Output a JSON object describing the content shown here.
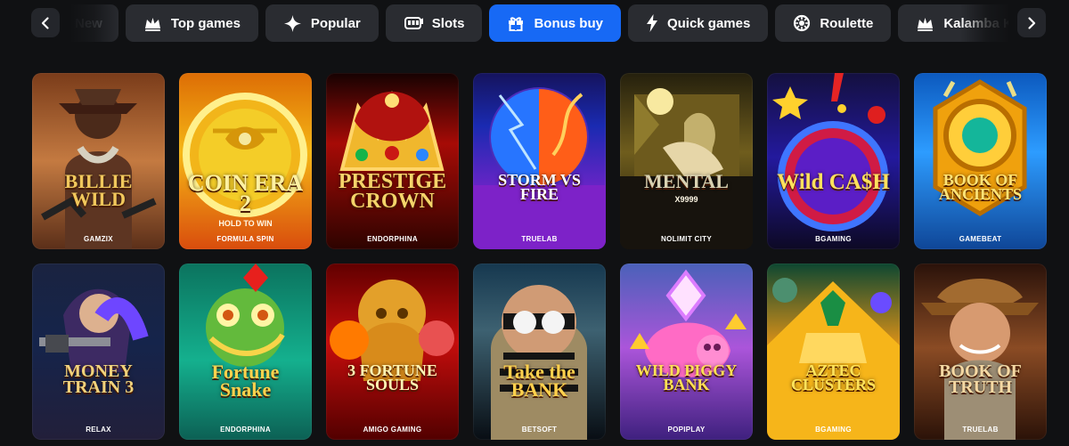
{
  "nav": {
    "prev_label": "‹",
    "next_label": "›",
    "categories": [
      {
        "label": "New",
        "icon": "new-icon",
        "active": false
      },
      {
        "label": "Top games",
        "icon": "crown-icon",
        "active": false
      },
      {
        "label": "Popular",
        "icon": "sparkle-icon",
        "active": false
      },
      {
        "label": "Slots",
        "icon": "slot-machine-icon",
        "active": false
      },
      {
        "label": "Bonus buy",
        "icon": "gift-icon",
        "active": true
      },
      {
        "label": "Quick games",
        "icon": "lightning-icon",
        "active": false
      },
      {
        "label": "Roulette",
        "icon": "roulette-icon",
        "active": false
      },
      {
        "label": "Kalamba Kash",
        "icon": "crown-icon",
        "active": false
      }
    ]
  },
  "games": [
    {
      "title": "BILLIE WILD",
      "provider": "GAMZIX",
      "title_color": "#f1c85c",
      "title_size": 22
    },
    {
      "title": "COIN ERA 2",
      "subtitle": "HOLD TO WIN",
      "provider": "FORMULA SPIN",
      "title_color": "#fff1a2",
      "title_size": 26
    },
    {
      "title": "PRESTIGE CROWN",
      "provider": "ENDORPHINA",
      "title_color": "#f5d46a",
      "title_size": 24
    },
    {
      "title": "STORM VS FIRE",
      "provider": "TRUELAB",
      "title_color": "#ffffff",
      "title_size": 18
    },
    {
      "title": "MENTAL",
      "subtitle": "X9999",
      "provider": "NOLIMIT CITY",
      "title_color": "#d9d2b2",
      "title_size": 22
    },
    {
      "title": "Wild CA$H",
      "provider": "BGAMING",
      "title_color": "#ffe15d",
      "title_size": 25
    },
    {
      "title": "BOOK OF ANCIENTS",
      "provider": "GAMEBEAT",
      "title_color": "#ffe477",
      "title_size": 18
    },
    {
      "title": "MONEY TRAIN 3",
      "provider": "RELAX",
      "title_color": "#f0d27c",
      "title_size": 20
    },
    {
      "title": "Fortune Snake",
      "provider": "ENDORPHINA",
      "title_color": "#ffd24d",
      "title_size": 22
    },
    {
      "title": "3 FORTUNE SOULS",
      "provider": "AMIGO GAMING",
      "title_color": "#fff4b4",
      "title_size": 18
    },
    {
      "title": "Take the BANK",
      "provider": "BETSOFT",
      "title_color": "#ffd14d",
      "title_size": 22
    },
    {
      "title": "WILD PIGGY BANK",
      "provider": "POPIPLAY",
      "title_color": "#ffe054",
      "title_size": 18
    },
    {
      "title": "AZTEC CLUSTERS",
      "provider": "BGAMING",
      "title_color": "#ffe35b",
      "title_size": 18
    },
    {
      "title": "BOOK OF TRUTH",
      "provider": "TRUELAB",
      "title_color": "#f4d8a3",
      "title_size": 20
    }
  ]
}
